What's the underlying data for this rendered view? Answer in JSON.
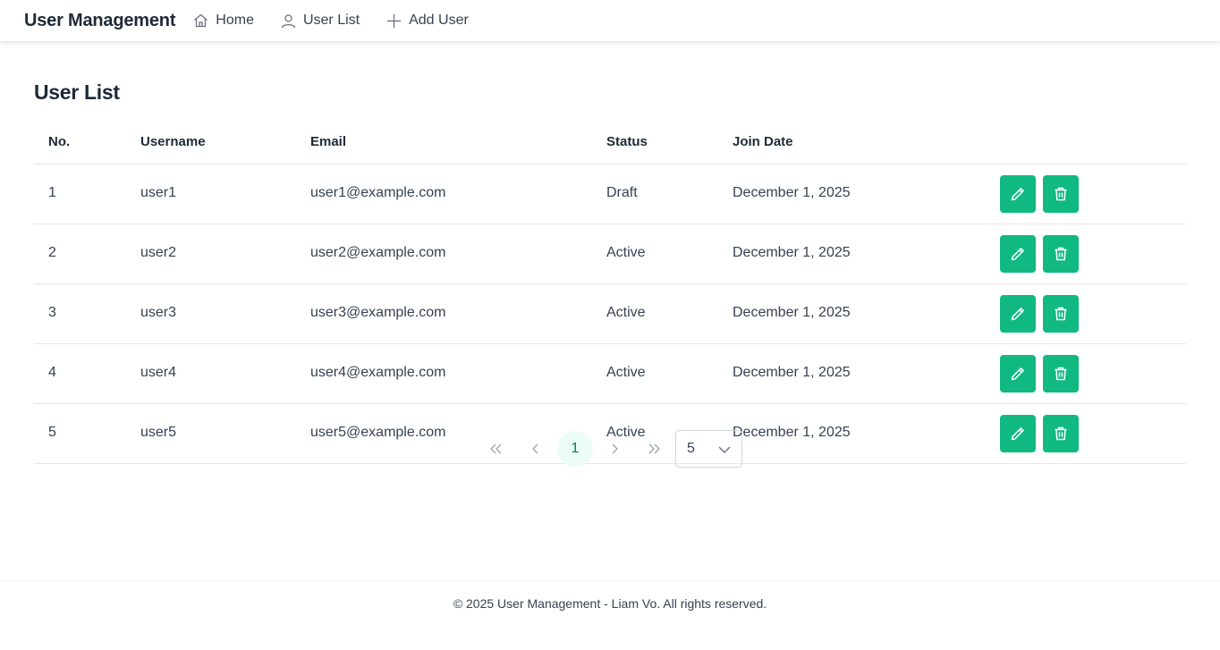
{
  "header": {
    "brand": "User Management",
    "nav": [
      {
        "label": "Home",
        "icon": "home-icon"
      },
      {
        "label": "User List",
        "icon": "user-icon"
      },
      {
        "label": "Add User",
        "icon": "plus-icon"
      }
    ]
  },
  "page": {
    "title": "User List"
  },
  "table": {
    "columns": [
      "No.",
      "Username",
      "Email",
      "Status",
      "Join Date"
    ],
    "rows": [
      {
        "no": "1",
        "username": "user1",
        "email": "user1@example.com",
        "status": "Draft",
        "join_date": "December 1, 2025"
      },
      {
        "no": "2",
        "username": "user2",
        "email": "user2@example.com",
        "status": "Active",
        "join_date": "December 1, 2025"
      },
      {
        "no": "3",
        "username": "user3",
        "email": "user3@example.com",
        "status": "Active",
        "join_date": "December 1, 2025"
      },
      {
        "no": "4",
        "username": "user4",
        "email": "user4@example.com",
        "status": "Active",
        "join_date": "December 1, 2025"
      },
      {
        "no": "5",
        "username": "user5",
        "email": "user5@example.com",
        "status": "Active",
        "join_date": "December 1, 2025"
      }
    ],
    "row_actions": {
      "edit_icon": "pencil-icon",
      "delete_icon": "trash-icon"
    }
  },
  "pagination": {
    "current_page": "1",
    "rows_per_page": "5"
  },
  "footer": {
    "text": "© 2025 User Management - Liam Vo. All rights reserved."
  },
  "colors": {
    "accent": "#10b981",
    "active_page_bg": "#ecfdf5",
    "active_page_text": "#047857"
  }
}
